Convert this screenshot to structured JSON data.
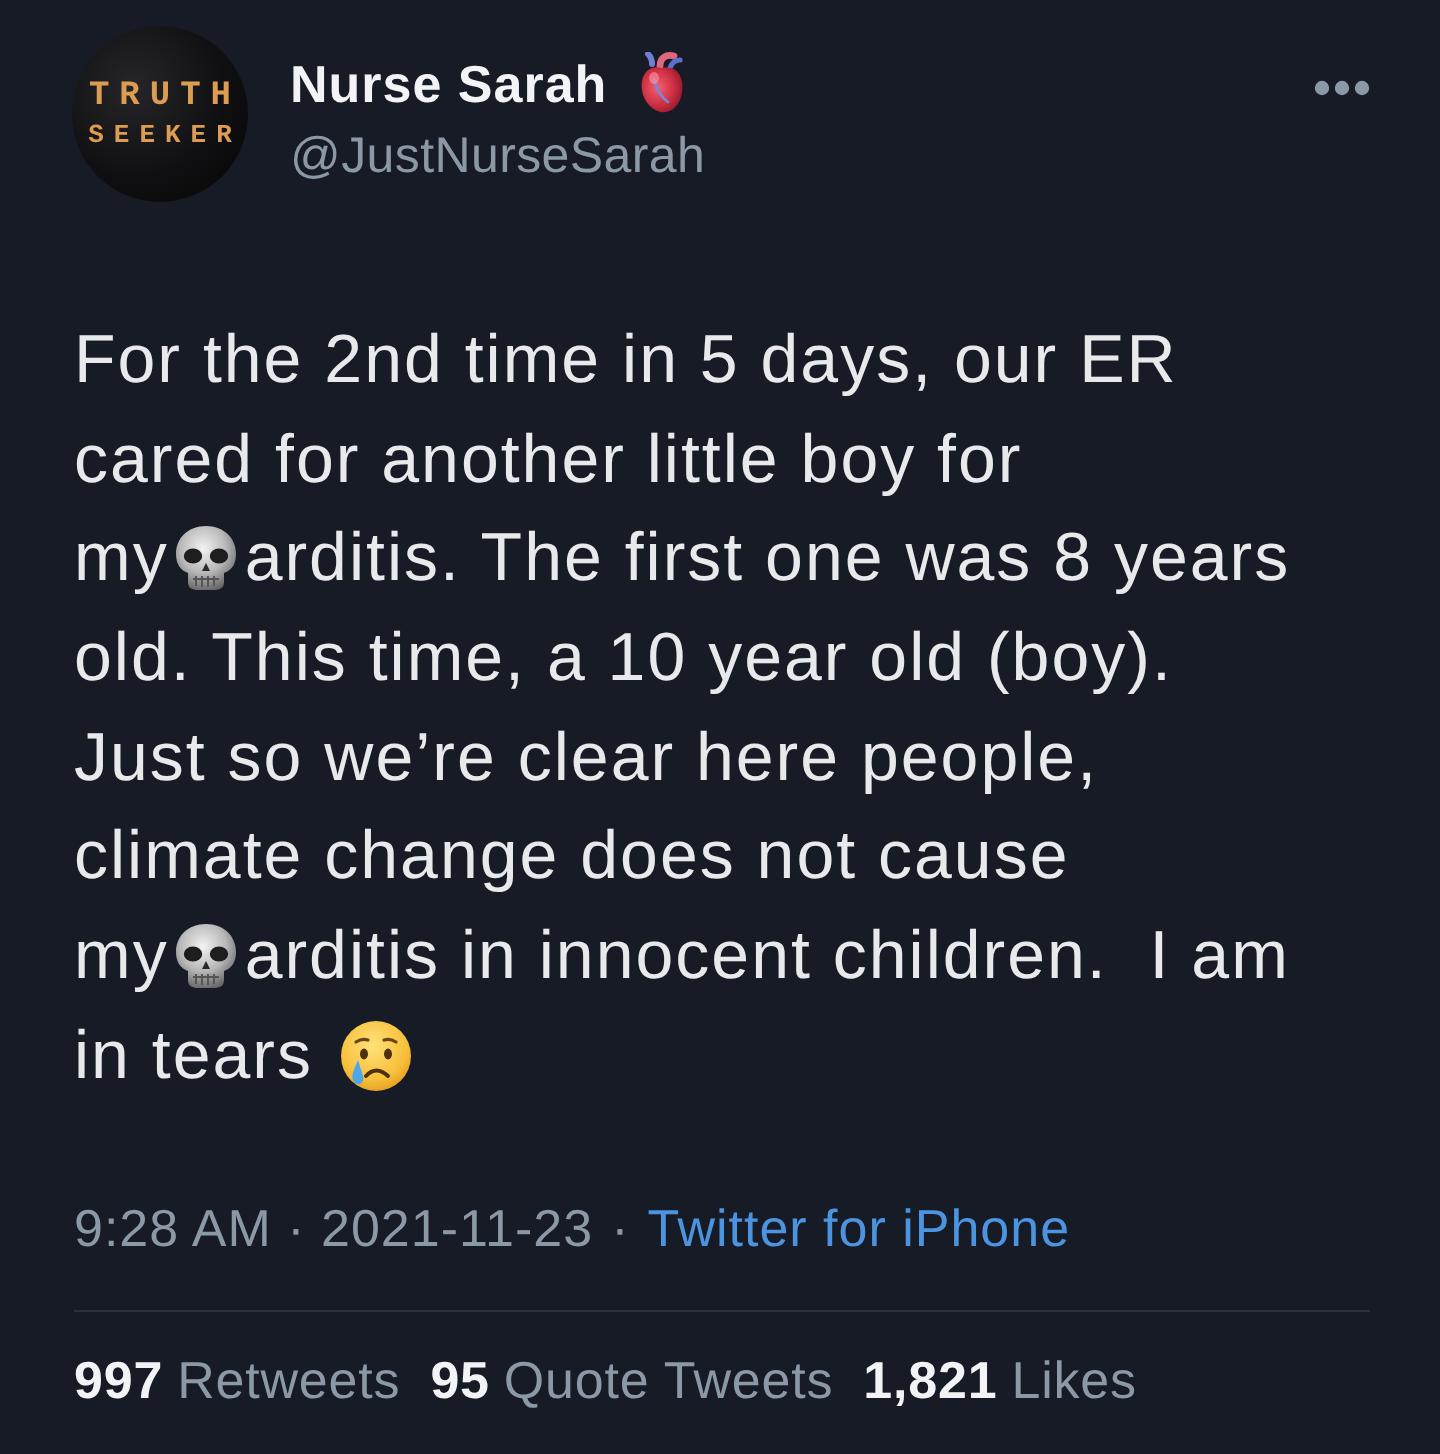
{
  "author": {
    "avatar_text": [
      "TRUTH",
      "SEEKER"
    ],
    "name": "Nurse Sarah",
    "handle": "@JustNurseSarah"
  },
  "body": {
    "lines": [
      {
        "segments": [
          {
            "kind": "text",
            "text": "For the 2nd time in 5 days, our ER"
          }
        ]
      },
      {
        "segments": [
          {
            "kind": "text",
            "text": "cared for another little boy for"
          }
        ]
      },
      {
        "segments": [
          {
            "kind": "text",
            "text": "my"
          },
          {
            "kind": "skull"
          },
          {
            "kind": "text",
            "text": "arditis. The first one was 8 years"
          }
        ]
      },
      {
        "segments": [
          {
            "kind": "text",
            "text": "old. This time, a 10 year old (boy)."
          }
        ]
      },
      {
        "segments": [
          {
            "kind": "text",
            "text": "Just so we’re clear here people,"
          }
        ]
      },
      {
        "segments": [
          {
            "kind": "text",
            "text": "climate change does not cause"
          }
        ]
      },
      {
        "segments": [
          {
            "kind": "text",
            "text": "my"
          },
          {
            "kind": "skull"
          },
          {
            "kind": "text",
            "text": "arditis in innocent children.  I am"
          }
        ]
      },
      {
        "segments": [
          {
            "kind": "text",
            "text": "in tears"
          },
          {
            "kind": "crying"
          }
        ]
      }
    ]
  },
  "meta": {
    "time": "9:28 AM · 2021-11-23",
    "separator": "·",
    "source": "Twitter for iPhone"
  },
  "stats": [
    {
      "count": "997",
      "label": "Retweets"
    },
    {
      "count": "95",
      "label": "Quote Tweets"
    },
    {
      "count": "1,821",
      "label": "Likes"
    }
  ]
}
